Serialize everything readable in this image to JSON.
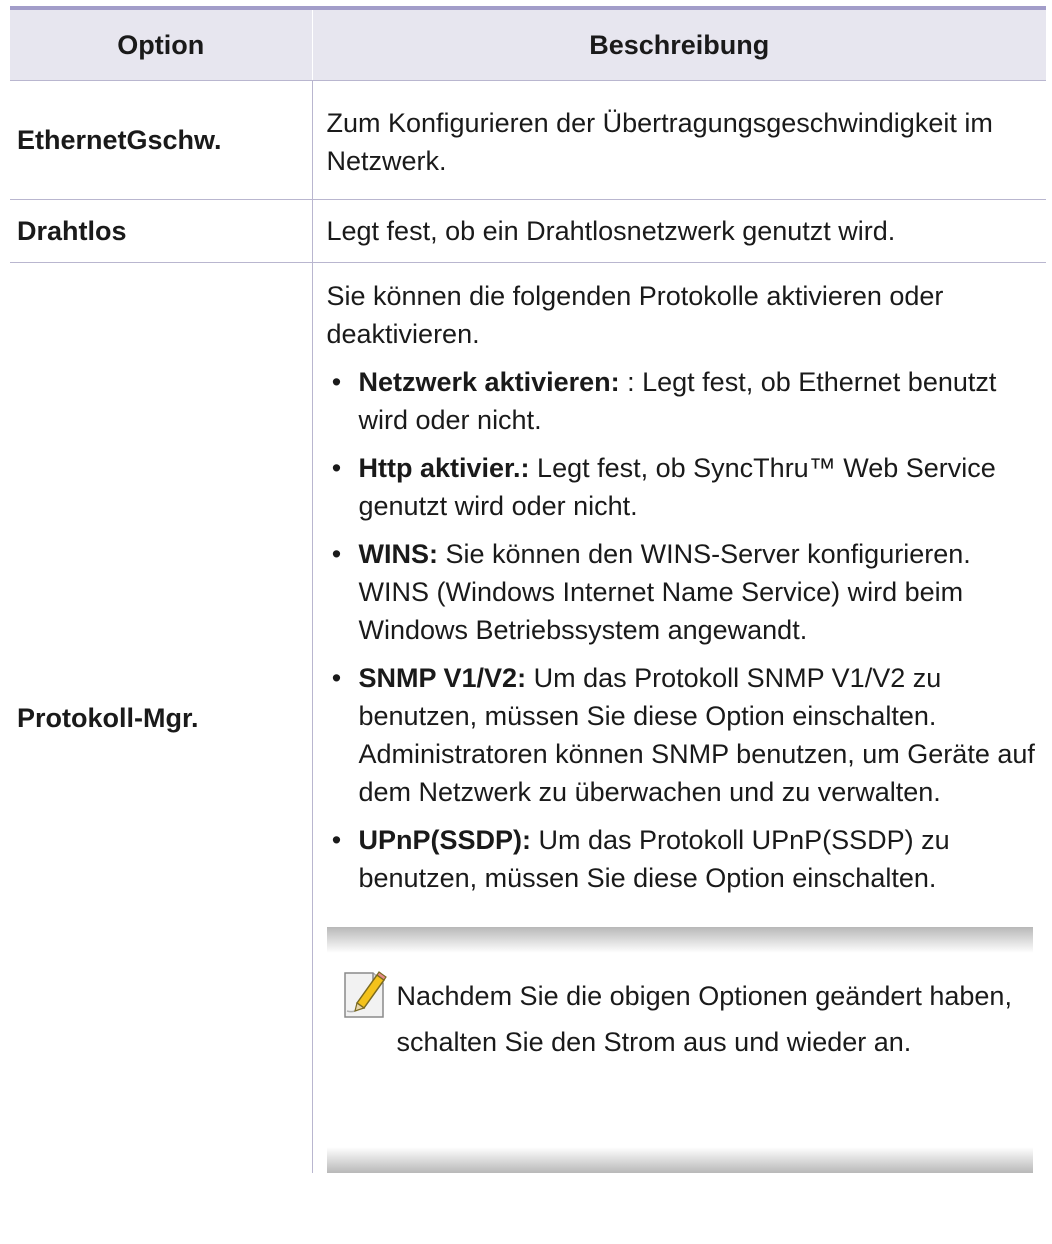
{
  "table": {
    "header": {
      "option": "Option",
      "description": "Beschreibung"
    },
    "rows": [
      {
        "option": "EthernetGschw.",
        "description": "Zum Konfigurieren der Übertragungsgeschwindigkeit im Netzwerk."
      },
      {
        "option": "Drahtlos",
        "description": "Legt fest, ob ein Drahtlosnetzwerk genutzt wird."
      },
      {
        "option": "Protokoll-Mgr.",
        "intro": "Sie können die folgenden Protokolle aktivieren oder deaktivieren.",
        "bullet": "•",
        "items": [
          {
            "term": "Netzwerk aktivieren:",
            "text": " : Legt fest, ob Ethernet benutzt wird oder nicht."
          },
          {
            "term": "Http aktivier.:",
            "text": " Legt fest, ob SyncThru™ Web Service genutzt wird oder nicht."
          },
          {
            "term": "WINS:",
            "text": " Sie können den WINS-Server konfigurieren. WINS (Windows Internet Name Service) wird beim Windows Betriebssystem angewandt."
          },
          {
            "term": "SNMP V1/V2:",
            "text": " Um das Protokoll SNMP V1/V2 zu benutzen, müssen Sie diese Option einschalten. Administratoren können SNMP benutzen, um Geräte auf dem Netzwerk zu überwachen und zu verwalten."
          },
          {
            "term": "UPnP(SSDP):",
            "text": " Um das Protokoll UPnP(SSDP) zu benutzen, müssen Sie diese Option einschalten."
          }
        ],
        "note": {
          "icon": "note-pencil-icon",
          "text": "Nachdem Sie die obigen Optionen geändert haben, schalten Sie den Strom aus und wieder an."
        }
      }
    ]
  },
  "colors": {
    "header_bg": "#e7e6ef",
    "header_rule": "#a29dc9",
    "row_rule": "#b9b6cf",
    "note_bar": "#b8b8b8"
  }
}
